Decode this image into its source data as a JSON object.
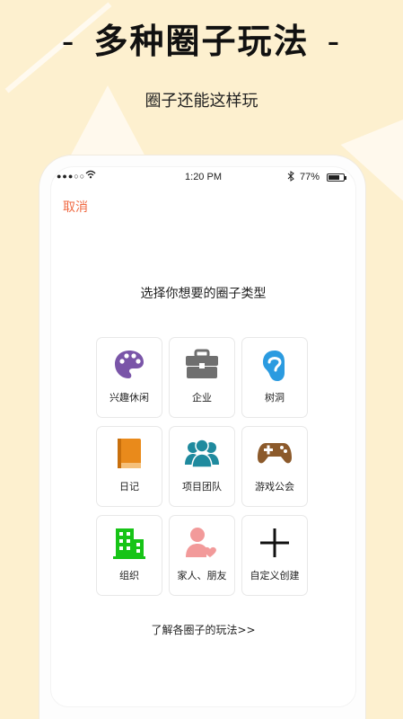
{
  "banner": {
    "title": "多种圈子玩法",
    "left_dash": "-",
    "right_dash": "-",
    "subtitle": "圈子还能这样玩"
  },
  "status_bar": {
    "signal": "●●●○○",
    "time": "1:20 PM",
    "battery": "77%",
    "battery_level": 0.77
  },
  "screen": {
    "cancel_label": "取消",
    "prompt": "选择你想要的圈子类型",
    "learn_more": "了解各圈子的玩法>>"
  },
  "circle_types": [
    {
      "label": "兴趣休闲",
      "icon": "palette-icon",
      "color": "#7a55a8"
    },
    {
      "label": "企业",
      "icon": "briefcase-icon",
      "color": "#6f6f6f"
    },
    {
      "label": "树洞",
      "icon": "ear-icon",
      "color": "#2b9be0"
    },
    {
      "label": "日记",
      "icon": "book-icon",
      "color": "#e98a1b"
    },
    {
      "label": "项目团队",
      "icon": "team-icon",
      "color": "#1f8a9e"
    },
    {
      "label": "游戏公会",
      "icon": "gamepad-icon",
      "color": "#8c5a2b"
    },
    {
      "label": "组织",
      "icon": "building-icon",
      "color": "#17c417"
    },
    {
      "label": "家人、朋友",
      "icon": "family-heart-icon",
      "color": "#f29a9a"
    },
    {
      "label": "自定义创建",
      "icon": "plus-icon",
      "color": "#111111"
    }
  ]
}
